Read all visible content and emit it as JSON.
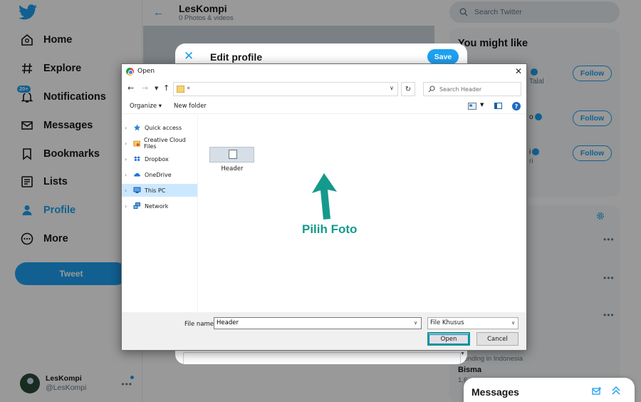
{
  "nav": {
    "items": [
      {
        "label": "Home",
        "icon": "home-icon"
      },
      {
        "label": "Explore",
        "icon": "hash-icon"
      },
      {
        "label": "Notifications",
        "icon": "bell-icon",
        "badge": "20+"
      },
      {
        "label": "Messages",
        "icon": "envelope-icon"
      },
      {
        "label": "Bookmarks",
        "icon": "bookmark-icon"
      },
      {
        "label": "Lists",
        "icon": "list-icon"
      },
      {
        "label": "Profile",
        "icon": "person-icon",
        "active": true
      },
      {
        "label": "More",
        "icon": "more-circle-icon"
      }
    ],
    "tweet_button": "Tweet",
    "account": {
      "name": "LesKompi",
      "handle": "@LesKompi"
    }
  },
  "profile_header": {
    "title": "LesKompi",
    "subtitle": "0 Photos & videos"
  },
  "search": {
    "placeholder": "Search Twitter"
  },
  "who_to_follow": {
    "title": "You might like",
    "rows": [
      {
        "name_fragment": "",
        "sub_fragment": "Talal",
        "button": "Follow"
      },
      {
        "name_fragment": "o",
        "sub_fragment": "",
        "button": "Follow"
      },
      {
        "name_fragment": "i",
        "sub_fragment": "ri",
        "button": "Follow"
      }
    ]
  },
  "trends": {
    "meta": "Trending in Indonesia",
    "name": "Bisma",
    "count": "1,6"
  },
  "messages_drawer": {
    "title": "Messages"
  },
  "edit_profile": {
    "title": "Edit profile",
    "save_label": "Save"
  },
  "dialog": {
    "title": "Open",
    "address": "«",
    "search_placeholder": "Search Header",
    "toolbar": {
      "organize": "Organize",
      "new_folder": "New folder"
    },
    "sidebar": [
      {
        "label": "Quick access",
        "icon": "star-icon"
      },
      {
        "label": "Creative Cloud Files",
        "icon": "cloud-folder-icon"
      },
      {
        "label": "Dropbox",
        "icon": "dropbox-icon"
      },
      {
        "label": "OneDrive",
        "icon": "onedrive-icon"
      },
      {
        "label": "This PC",
        "icon": "pc-icon",
        "selected": true
      },
      {
        "label": "Network",
        "icon": "network-icon"
      }
    ],
    "files": [
      {
        "label": "Header"
      }
    ],
    "annotation": "Pilih Foto",
    "file_name_label": "File name:",
    "file_name_value": "Header",
    "file_type": "File Khusus",
    "open_label": "Open",
    "cancel_label": "Cancel"
  },
  "colors": {
    "twitter_blue": "#1da1f2",
    "annotation_teal": "#149a8c",
    "selected_row": "#cce8ff"
  }
}
